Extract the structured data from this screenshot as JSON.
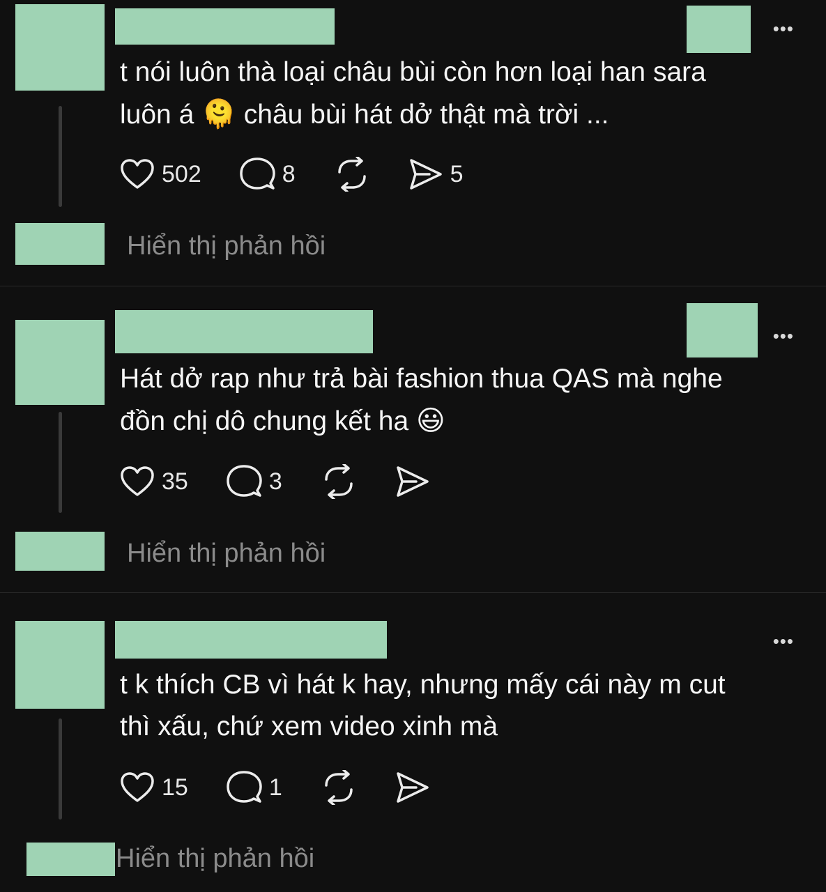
{
  "colors": {
    "background": "#101010",
    "redaction": "#9fd3b4",
    "muted_text": "#8b8b8b"
  },
  "comments": [
    {
      "text_line1": "t nói luôn thà loại châu bùi còn hơn loại han sara",
      "text_line2_before": "luôn á",
      "text_line2_emoji": "🫠",
      "text_line2_after": "châu bùi hát dở thật mà trời ...",
      "likes": "502",
      "replies_count": "8",
      "reposts": "",
      "shares": "5",
      "show_replies": "Hiển thị phản hồi",
      "more": "•••"
    },
    {
      "text_line1": "Hát dở rap như trả bài fashion thua QAS mà nghe",
      "text_line2_before": "đồn chị dô chung kết ha",
      "text_line2_emoji": "😃",
      "text_line2_after": "",
      "likes": "35",
      "replies_count": "3",
      "reposts": "",
      "shares": "",
      "show_replies": "Hiển thị phản hồi",
      "more": "•••"
    },
    {
      "text_line1": "t k thích CB vì hát k hay, nhưng mấy cái này m cut",
      "text_line2_before": "thì xấu, chứ xem video xinh mà",
      "text_line2_emoji": "",
      "text_line2_after": "",
      "likes": "15",
      "replies_count": "1",
      "reposts": "",
      "shares": "",
      "show_replies": "Hiển thị phản hồi",
      "more": "•••"
    }
  ],
  "icons": {
    "like": "heart-icon",
    "reply": "comment-bubble-icon",
    "repost": "repost-icon",
    "share": "send-icon",
    "more": "more-dots-icon"
  }
}
